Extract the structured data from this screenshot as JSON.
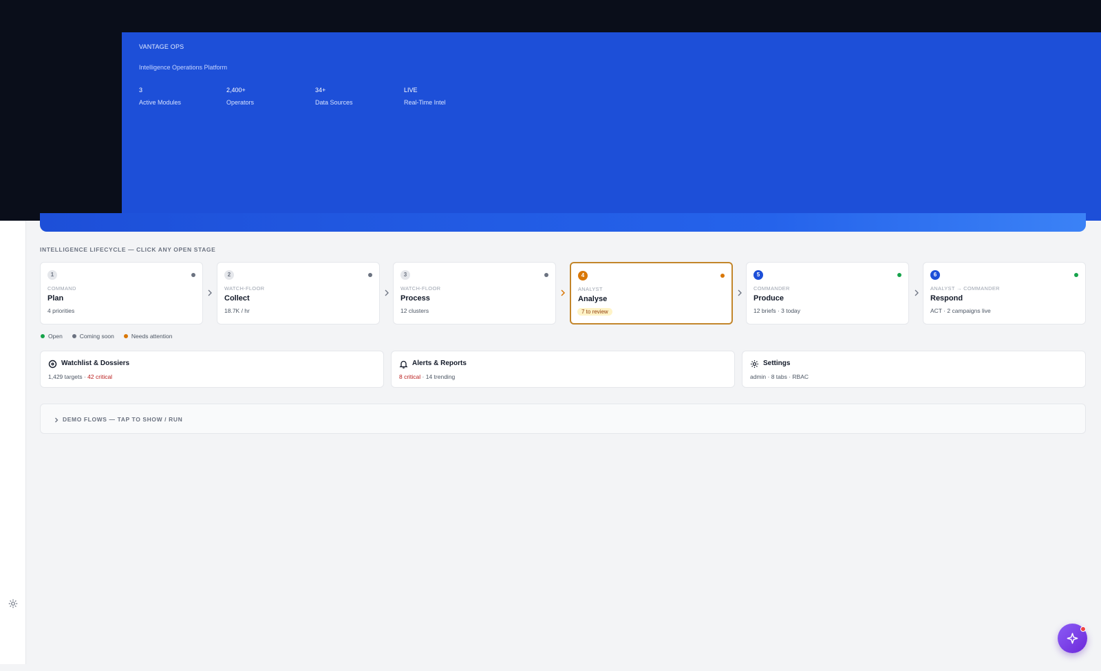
{
  "hero": {
    "brand": "VANTAGE OPS",
    "subtitle": "Intelligence Operations Platform",
    "stats": [
      {
        "value": "3",
        "label": "Active Modules"
      },
      {
        "value": "2,400+",
        "label": "Operators"
      },
      {
        "value": "34+",
        "label": "Data Sources"
      },
      {
        "value": "LIVE",
        "label": "Real-Time Intel"
      }
    ]
  },
  "lifecycle": {
    "heading": "INTELLIGENCE LIFECYCLE — CLICK ANY OPEN STAGE",
    "stages": [
      {
        "num": "1",
        "role": "COMMAND",
        "title": "Plan",
        "meta": "4 priorities",
        "status": "coming-soon"
      },
      {
        "num": "2",
        "role": "WATCH-FLOOR",
        "title": "Collect",
        "meta": "18.7K / hr",
        "status": "coming-soon"
      },
      {
        "num": "3",
        "role": "WATCH-FLOOR",
        "title": "Process",
        "meta": "12 clusters",
        "status": "coming-soon"
      },
      {
        "num": "4",
        "role": "ANALYST",
        "title": "Analyse",
        "badge": "7 to review",
        "status": "needs-attention"
      },
      {
        "num": "5",
        "role": "COMMANDER",
        "title": "Produce",
        "meta": "12 briefs · 3 today",
        "status": "open"
      },
      {
        "num": "6",
        "role": "ANALYST → COMMANDER",
        "title": "Respond",
        "meta": "ACT · 2 campaigns live",
        "status": "open"
      }
    ],
    "legend": {
      "open": "Open",
      "coming_soon": "Coming soon",
      "needs_attention": "Needs attention"
    }
  },
  "modules": {
    "watchlist": {
      "title": "Watchlist & Dossiers",
      "meta_a": "1,429 targets · ",
      "meta_b": "42 critical",
      "icon": "target-icon"
    },
    "alerts": {
      "title": "Alerts & Reports",
      "meta_a": "8 critical",
      "meta_b": " · 14 trending",
      "icon": "bell-icon"
    },
    "settings": {
      "title": "Settings",
      "meta": "admin · 8 tabs · RBAC",
      "icon": "gear-icon"
    }
  },
  "demo": {
    "label": "DEMO FLOWS — TAP TO SHOW / RUN"
  },
  "colors": {
    "hero_blue": "#1d4fd8",
    "dark": "#0a0e1a",
    "open": "#16a34a",
    "coming_soon": "#6b7280",
    "needs_attention": "#d97706",
    "critical": "#b91c1c",
    "fab": "#7c3aed"
  }
}
